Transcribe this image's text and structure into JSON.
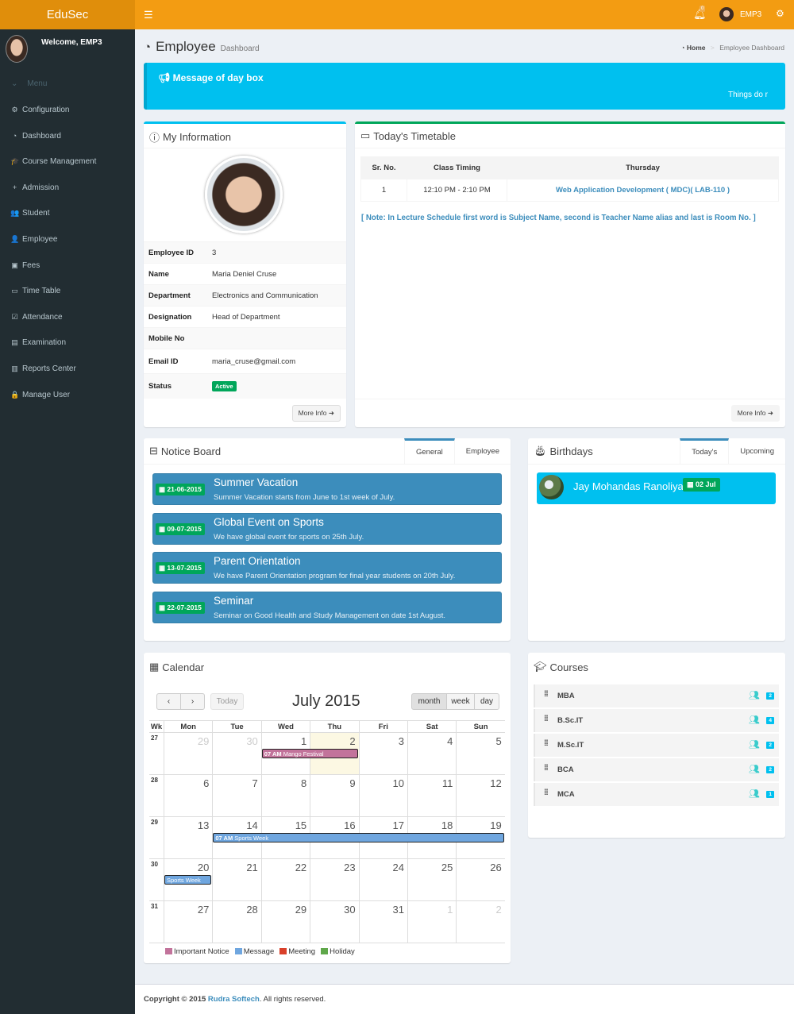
{
  "header": {
    "logo": "EduSec",
    "menu_icon": "hamburger-icon",
    "notification_count": "0",
    "user_name": "EMP3"
  },
  "sidebar": {
    "welcome": "Welcome, EMP3",
    "menu_label": "Menu",
    "items": [
      {
        "label": "Configuration",
        "icon": "⚙"
      },
      {
        "label": "Dashboard",
        "icon": "◔"
      },
      {
        "label": "Course Management",
        "icon": "🎓"
      },
      {
        "label": "Admission",
        "icon": "+"
      },
      {
        "label": "Student",
        "icon": "👥"
      },
      {
        "label": "Employee",
        "icon": "👤"
      },
      {
        "label": "Fees",
        "icon": "▣"
      },
      {
        "label": "Time Table",
        "icon": "▭"
      },
      {
        "label": "Attendance",
        "icon": "☑"
      },
      {
        "label": "Examination",
        "icon": "▤"
      },
      {
        "label": "Reports Center",
        "icon": "▥"
      },
      {
        "label": "Manage User",
        "icon": "🔒"
      }
    ]
  },
  "page": {
    "title": "Employee",
    "subtitle": "Dashboard",
    "breadcrumb": {
      "home": "Home",
      "current": "Employee Dashboard"
    }
  },
  "message_box": {
    "title": "Message of day box",
    "marquee": "Things do r"
  },
  "my_information": {
    "title": "My Information",
    "rows": [
      {
        "label": "Employee ID",
        "value": "3"
      },
      {
        "label": "Name",
        "value": "Maria Deniel Cruse"
      },
      {
        "label": "Department",
        "value": "Electronics and Communication"
      },
      {
        "label": "Designation",
        "value": "Head of Department"
      },
      {
        "label": "Mobile No",
        "value": ""
      },
      {
        "label": "Email ID",
        "value": "maria_cruse@gmail.com"
      },
      {
        "label": "Status",
        "value": "Active"
      }
    ],
    "more_info": "More Info"
  },
  "timetable": {
    "title": "Today's Timetable",
    "headers": [
      "Sr. No.",
      "Class Timing",
      "Thursday"
    ],
    "rows": [
      {
        "sr": "1",
        "timing": "12:10 PM - 2:10 PM",
        "subject": "Web Application Development ( MDC)( LAB-110 )"
      }
    ],
    "note": "[ Note: In Lecture Schedule first word is Subject Name, second is Teacher Name alias and last is Room No. ]",
    "more_info": "More Info"
  },
  "notice_board": {
    "title": "Notice Board",
    "tabs": [
      "General",
      "Employee"
    ],
    "active_tab": "General",
    "notices": [
      {
        "date": "21-06-2015",
        "title": "Summer Vacation",
        "desc": "Summer Vacation starts from June to 1st week of July."
      },
      {
        "date": "09-07-2015",
        "title": "Global Event on Sports",
        "desc": "We have global event for sports on 25th July."
      },
      {
        "date": "13-07-2015",
        "title": "Parent Orientation",
        "desc": "We have Parent Orientation program for final year students on 20th July."
      },
      {
        "date": "22-07-2015",
        "title": "Seminar",
        "desc": "Seminar on Good Health and Study Management on date 1st August."
      }
    ]
  },
  "birthdays": {
    "title": "Birthdays",
    "tabs": [
      "Today's",
      "Upcoming"
    ],
    "active_tab": "Today's",
    "entries": [
      {
        "name": "Jay Mohandas Ranoliya",
        "date": "02 Jul"
      }
    ]
  },
  "calendar": {
    "title": "Calendar",
    "month_title": "July 2015",
    "today_label": "Today",
    "prev": "‹",
    "next": "›",
    "views": [
      "month",
      "week",
      "day"
    ],
    "active_view": "month",
    "week_header": "Wk",
    "day_headers": [
      "Mon",
      "Tue",
      "Wed",
      "Thu",
      "Fri",
      "Sat",
      "Sun"
    ],
    "weeks": [
      {
        "wk": "27",
        "days": [
          "29",
          "30",
          "1",
          "2",
          "3",
          "4",
          "5"
        ]
      },
      {
        "wk": "28",
        "days": [
          "6",
          "7",
          "8",
          "9",
          "10",
          "11",
          "12"
        ]
      },
      {
        "wk": "29",
        "days": [
          "13",
          "14",
          "15",
          "16",
          "17",
          "18",
          "19"
        ]
      },
      {
        "wk": "30",
        "days": [
          "20",
          "21",
          "22",
          "23",
          "24",
          "25",
          "26"
        ]
      },
      {
        "wk": "31",
        "days": [
          "27",
          "28",
          "29",
          "30",
          "31",
          "1",
          "2"
        ]
      }
    ],
    "events": [
      {
        "time": "07 AM",
        "title": "Mango Festival",
        "color": "#c2739b"
      },
      {
        "time": "07 AM",
        "title": "Sports Week",
        "color": "#6fa6df"
      },
      {
        "time": "",
        "title": "Sports Week",
        "color": "#6fa6df"
      }
    ],
    "legend": [
      {
        "label": "Important Notice",
        "color": "#c2739b"
      },
      {
        "label": "Message",
        "color": "#6fa6df"
      },
      {
        "label": "Meeting",
        "color": "#d9402a"
      },
      {
        "label": "Holiday",
        "color": "#5fa74a"
      }
    ]
  },
  "courses": {
    "title": "Courses",
    "items": [
      {
        "name": "MBA",
        "count": "2"
      },
      {
        "name": "B.Sc.IT",
        "count": "4"
      },
      {
        "name": "M.Sc.IT",
        "count": "2"
      },
      {
        "name": "BCA",
        "count": "2"
      },
      {
        "name": "MCA",
        "count": "1"
      }
    ]
  },
  "footer": {
    "prefix": "Copyright © 2015",
    "company": "Rudra Softech",
    "suffix": ". All rights reserved."
  }
}
